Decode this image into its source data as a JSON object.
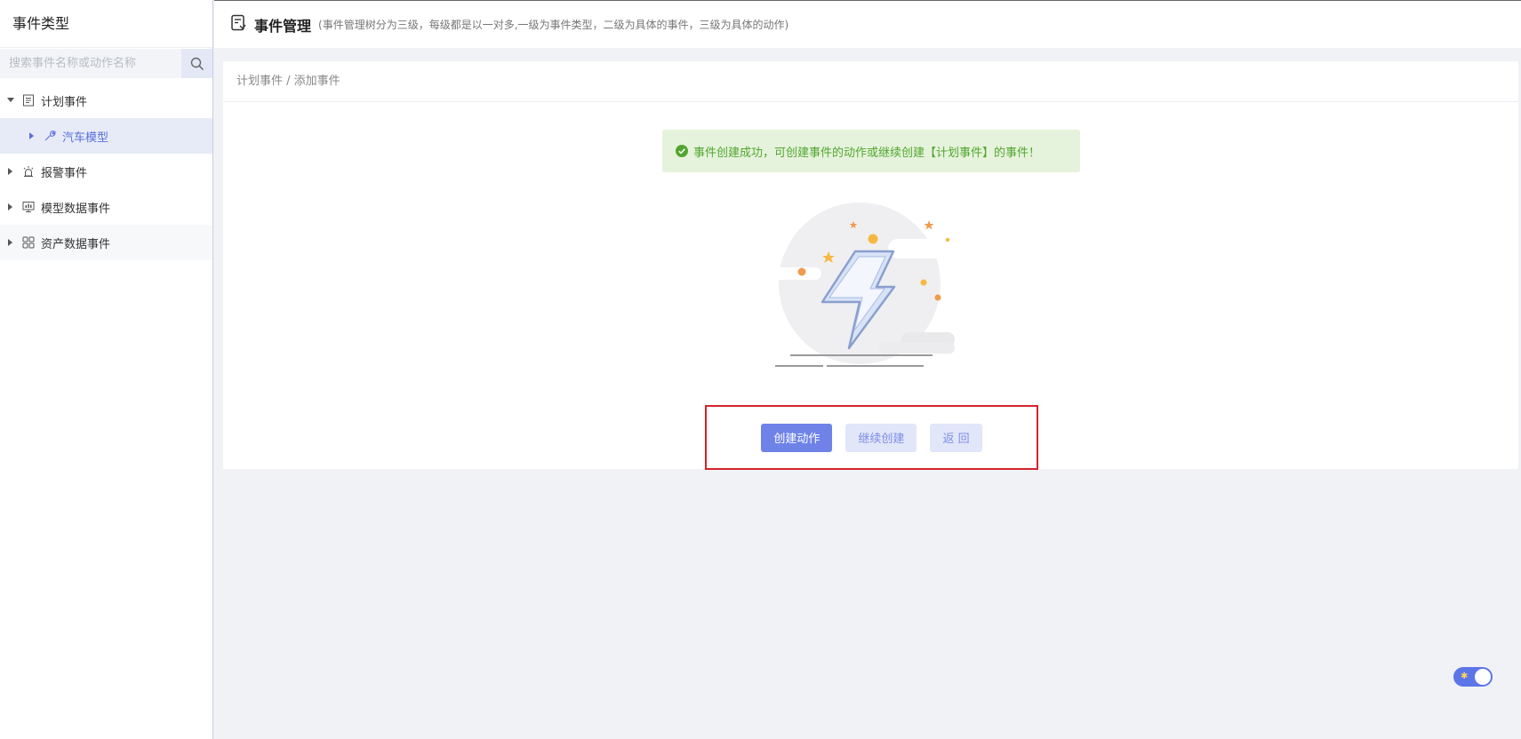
{
  "sidebar": {
    "title": "事件类型",
    "search_placeholder": "搜索事件名称或动作名称",
    "items": [
      {
        "label": "计划事件",
        "expanded": true,
        "icon": "document-icon",
        "children": [
          {
            "label": "汽车模型",
            "icon": "wrench-icon",
            "selected": true
          }
        ]
      },
      {
        "label": "报警事件",
        "icon": "alarm-icon"
      },
      {
        "label": "模型数据事件",
        "icon": "monitor-chart-icon"
      },
      {
        "label": "资产数据事件",
        "icon": "grid-icon"
      }
    ]
  },
  "header": {
    "title": "事件管理",
    "subtitle": "(事件管理树分为三级，每级都是以一对多,一级为事件类型，二级为具体的事件，三级为具体的动作)",
    "icon": "event-doc-icon"
  },
  "main": {
    "breadcrumb": "计划事件 / 添加事件",
    "alert": "事件创建成功，可创建事件的动作或继续创建【计划事件】的事件！",
    "buttons": {
      "create_action": "创建动作",
      "continue_create": "继续创建",
      "back": "返 回"
    }
  },
  "colors": {
    "primary": "#6e82e8",
    "success": "#52a62f",
    "highlight_border": "#d5232b"
  }
}
